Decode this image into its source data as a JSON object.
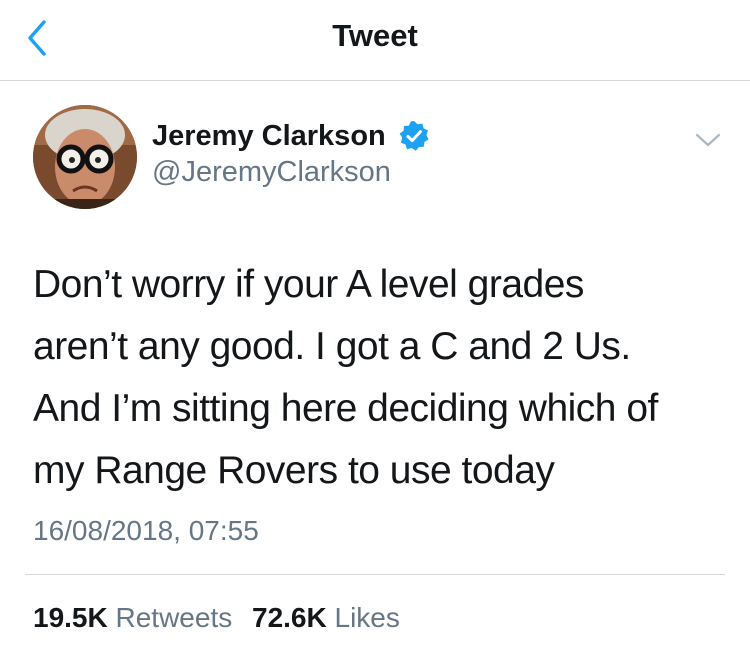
{
  "header": {
    "title": "Tweet",
    "back_icon": "chevron-left-icon",
    "accent_color": "#1da1f2"
  },
  "author": {
    "name": "Jeremy Clarkson",
    "handle": "@JeremyClarkson",
    "verified": true,
    "verified_icon": "verified-badge-icon",
    "menu_icon": "chevron-down-icon"
  },
  "tweet": {
    "lines": [
      "Don’t worry if your A level grades",
      "aren’t any good. I got a C and 2 Us.",
      "And I’m sitting here deciding which of",
      "my Range Rovers to use today"
    ],
    "timestamp": "16/08/2018, 07:55"
  },
  "stats": {
    "retweets_count": "19.5K",
    "retweets_label": "Retweets",
    "likes_count": "72.6K",
    "likes_label": "Likes"
  }
}
